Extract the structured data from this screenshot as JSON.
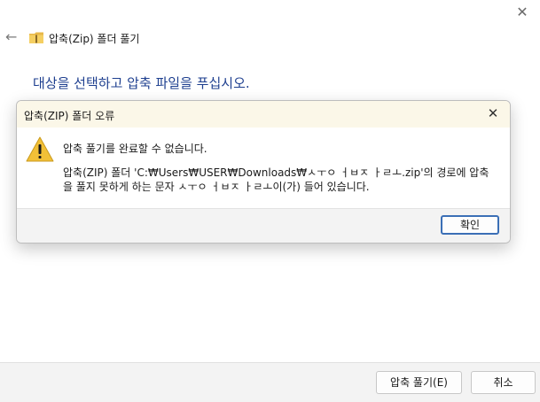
{
  "wizard": {
    "title": "압축(Zip) 폴더 풀기",
    "heading": "대상을 선택하고 압축 파일을 푸십시오.",
    "extract_button": "압축 풀기(E)",
    "cancel_button": "취소"
  },
  "dialog": {
    "title": "압축(ZIP) 폴더 오류",
    "message": "압축 풀기를 완료할 수 없습니다.",
    "detail": "압축(ZIP) 폴더 'C:₩Users₩USER₩Downloads₩ㅅㅜㅇ ㅓㅂㅈ ㅏㄹㅗ.zip'의 경로에 압축을 풀지 못하게 하는 문자 ㅅㅜㅇ ㅓㅂㅈ ㅏㄹㅗ이(가) 들어 있습니다.",
    "ok_button": "확인"
  },
  "icons": {
    "back": "back-arrow-icon",
    "folder": "zip-folder-icon",
    "warning": "warning-icon",
    "close": "close-icon"
  },
  "colors": {
    "heading": "#1e3f8f",
    "warning": "#f2c037",
    "ok_border": "#3b6fb6"
  }
}
